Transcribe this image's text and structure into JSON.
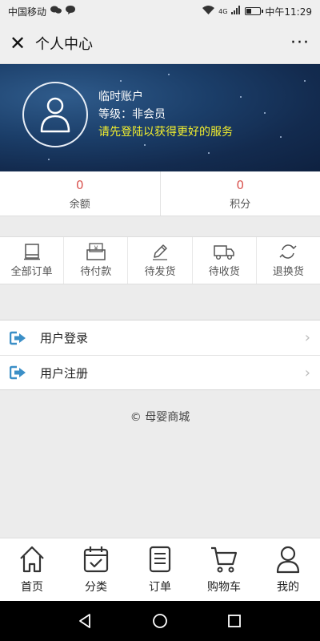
{
  "status_bar": {
    "carrier": "中国移动",
    "network": "4G",
    "time": "中午11:29",
    "battery_level": 0.3
  },
  "header": {
    "title": "个人中心",
    "close_icon": "close-icon",
    "more_icon": "more-icon"
  },
  "profile": {
    "account_name": "临时账户",
    "level": "等级：非会员",
    "prompt": "请先登陆以获得更好的服务",
    "prompt_color": "#f3ef2d"
  },
  "stats": [
    {
      "value": "0",
      "label": "余额"
    },
    {
      "value": "0",
      "label": "积分"
    }
  ],
  "orders": [
    {
      "label": "全部订单",
      "icon": "all-orders-icon"
    },
    {
      "label": "待付款",
      "icon": "pending-payment-icon"
    },
    {
      "label": "待发货",
      "icon": "pending-shipment-icon"
    },
    {
      "label": "待收货",
      "icon": "pending-receipt-icon"
    },
    {
      "label": "退换货",
      "icon": "returns-icon"
    }
  ],
  "menu": [
    {
      "label": "用户登录",
      "icon": "sign-in-icon"
    },
    {
      "label": "用户注册",
      "icon": "sign-in-icon"
    }
  ],
  "footer": {
    "copyright": "© 母婴商城"
  },
  "tabbar": [
    {
      "label": "首页",
      "icon": "home-icon"
    },
    {
      "label": "分类",
      "icon": "category-icon"
    },
    {
      "label": "订单",
      "icon": "order-list-icon"
    },
    {
      "label": "购物车",
      "icon": "cart-icon"
    },
    {
      "label": "我的",
      "icon": "user-icon"
    }
  ],
  "colors": {
    "accent_red": "#d9534f",
    "menu_icon_blue": "#3b8fc7"
  }
}
